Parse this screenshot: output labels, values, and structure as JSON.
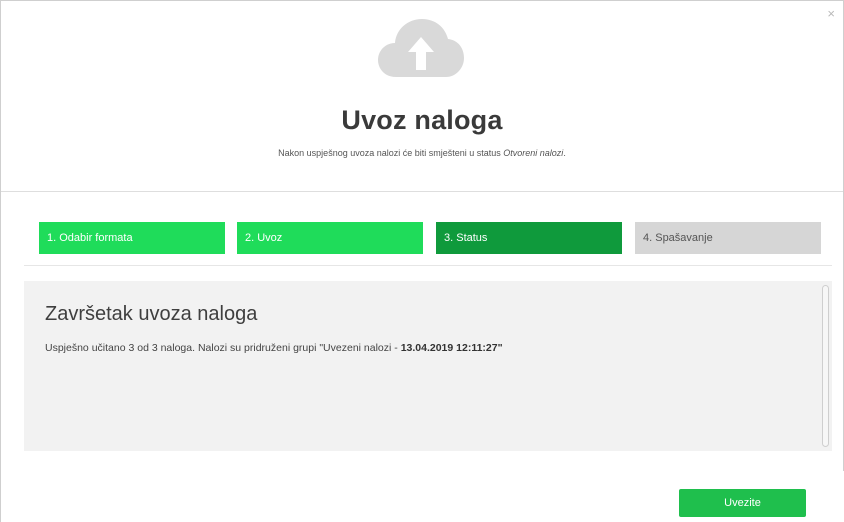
{
  "dialog": {
    "close_symbol": "×",
    "icon": "cloud-upload-icon",
    "title": "Uvoz naloga",
    "subtitle_prefix": "Nakon uspješnog uvoza nalozi će biti smješteni u status ",
    "subtitle_status": "Otvoreni nalozi",
    "subtitle_suffix": "."
  },
  "steps": [
    {
      "label": "1. Odabir formata",
      "state": "done"
    },
    {
      "label": "2. Uvoz",
      "state": "done"
    },
    {
      "label": "3. Status",
      "state": "active"
    },
    {
      "label": "4. Spašavanje",
      "state": "pending"
    }
  ],
  "content": {
    "title": "Završetak uvoza naloga",
    "message_prefix": "Uspješno učitano 3 od 3 naloga. Nalozi su pridruženi grupi \"Uvezeni nalozi - ",
    "message_bold": "13.04.2019 12:11:27\"",
    "message_suffix": ""
  },
  "footer": {
    "import_button_label": "Uvezite"
  },
  "colors": {
    "step_done": "#1fdc5a",
    "step_active": "#0f9a3c",
    "step_pending": "#d6d6d6",
    "button": "#1fbf4d",
    "panel": "#f2f2f2",
    "cloud_icon": "#d9d9d9"
  }
}
